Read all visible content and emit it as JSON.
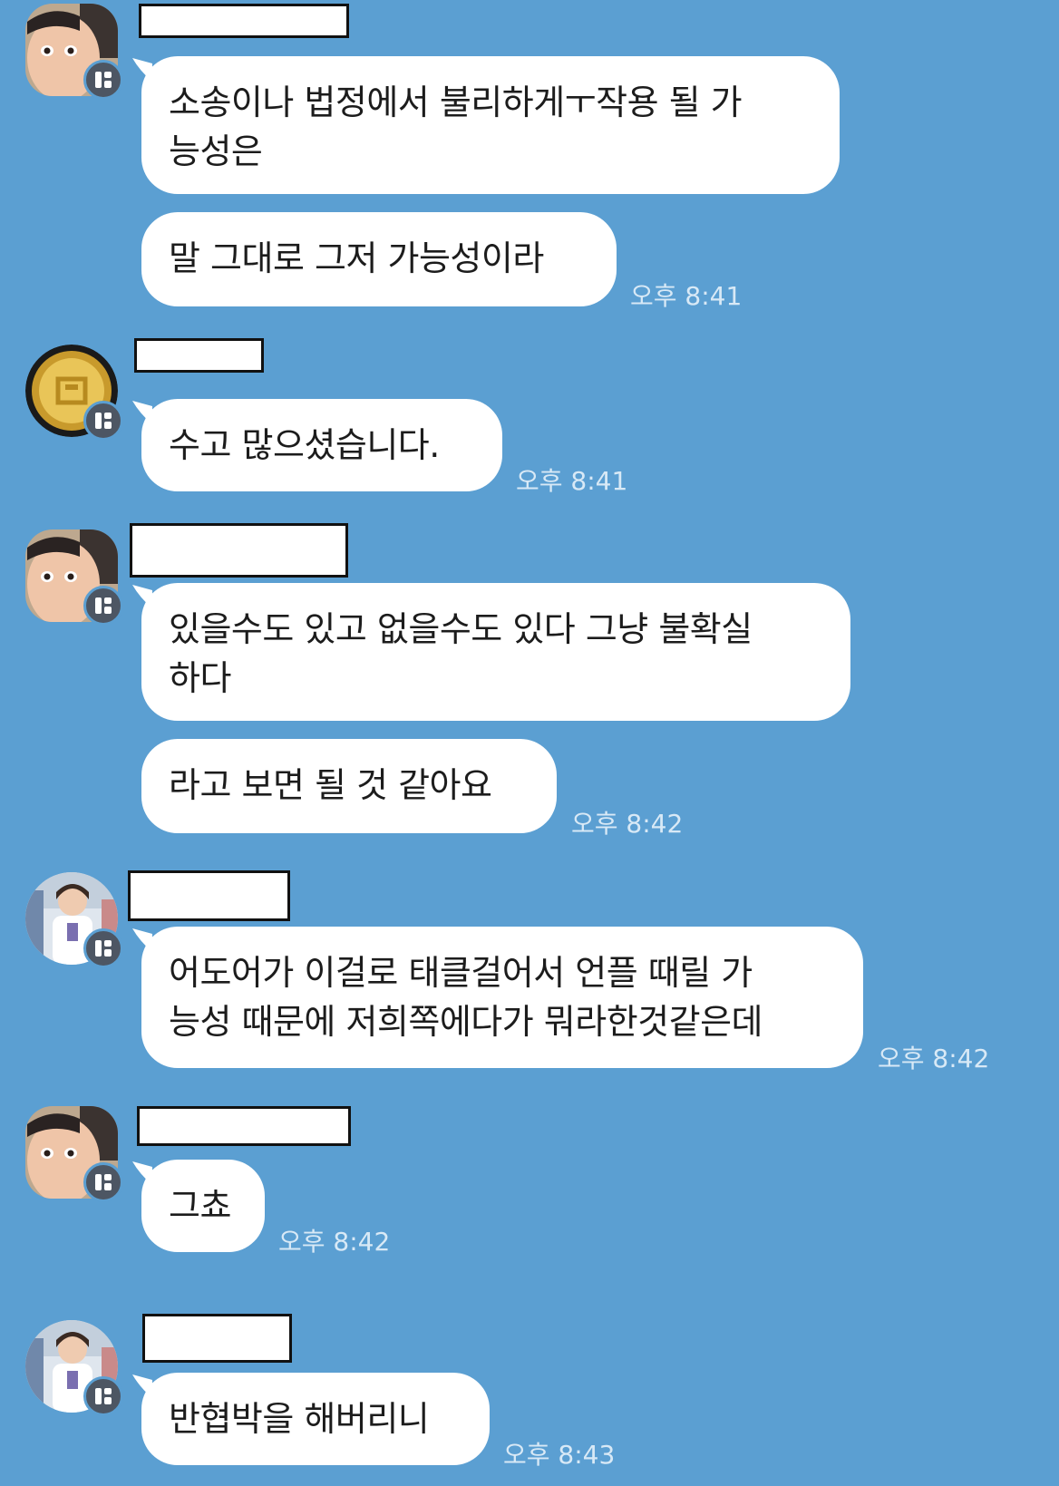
{
  "colors": {
    "background": "#5b9fd2",
    "bubble": "#ffffff",
    "time_text": "#d8e9f6",
    "badge": "#4d5663"
  },
  "messages": [
    {
      "sender_avatar": "photo-face",
      "lines": [
        "소송이나 법정에서 불리하게ㅜ작용 될 가",
        "능성은"
      ]
    },
    {
      "sender_avatar": "photo-face",
      "lines": [
        "말 그대로 그저 가능성이라"
      ],
      "time": "오후 8:41"
    },
    {
      "sender_avatar": "pixel-coin",
      "lines": [
        "수고 많으셨습니다."
      ],
      "time": "오후 8:41"
    },
    {
      "sender_avatar": "photo-face",
      "lines": [
        "있을수도 있고 없을수도 있다 그냥 불확실",
        "하다"
      ]
    },
    {
      "sender_avatar": "photo-face",
      "lines": [
        "라고 보면 될 것 같아요"
      ],
      "time": "오후 8:42"
    },
    {
      "sender_avatar": "photo-person",
      "lines": [
        "어도어가 이걸로 태클걸어서 언플 때릴 가",
        "능성 때문에 저희쪽에다가 뭐라한것같은데"
      ],
      "time": "오후 8:42"
    },
    {
      "sender_avatar": "photo-face",
      "lines": [
        "그쵸"
      ],
      "time": "오후 8:42"
    },
    {
      "sender_avatar": "photo-person",
      "lines": [
        "반협박을 해버리니"
      ],
      "time": "오후 8:43"
    }
  ]
}
